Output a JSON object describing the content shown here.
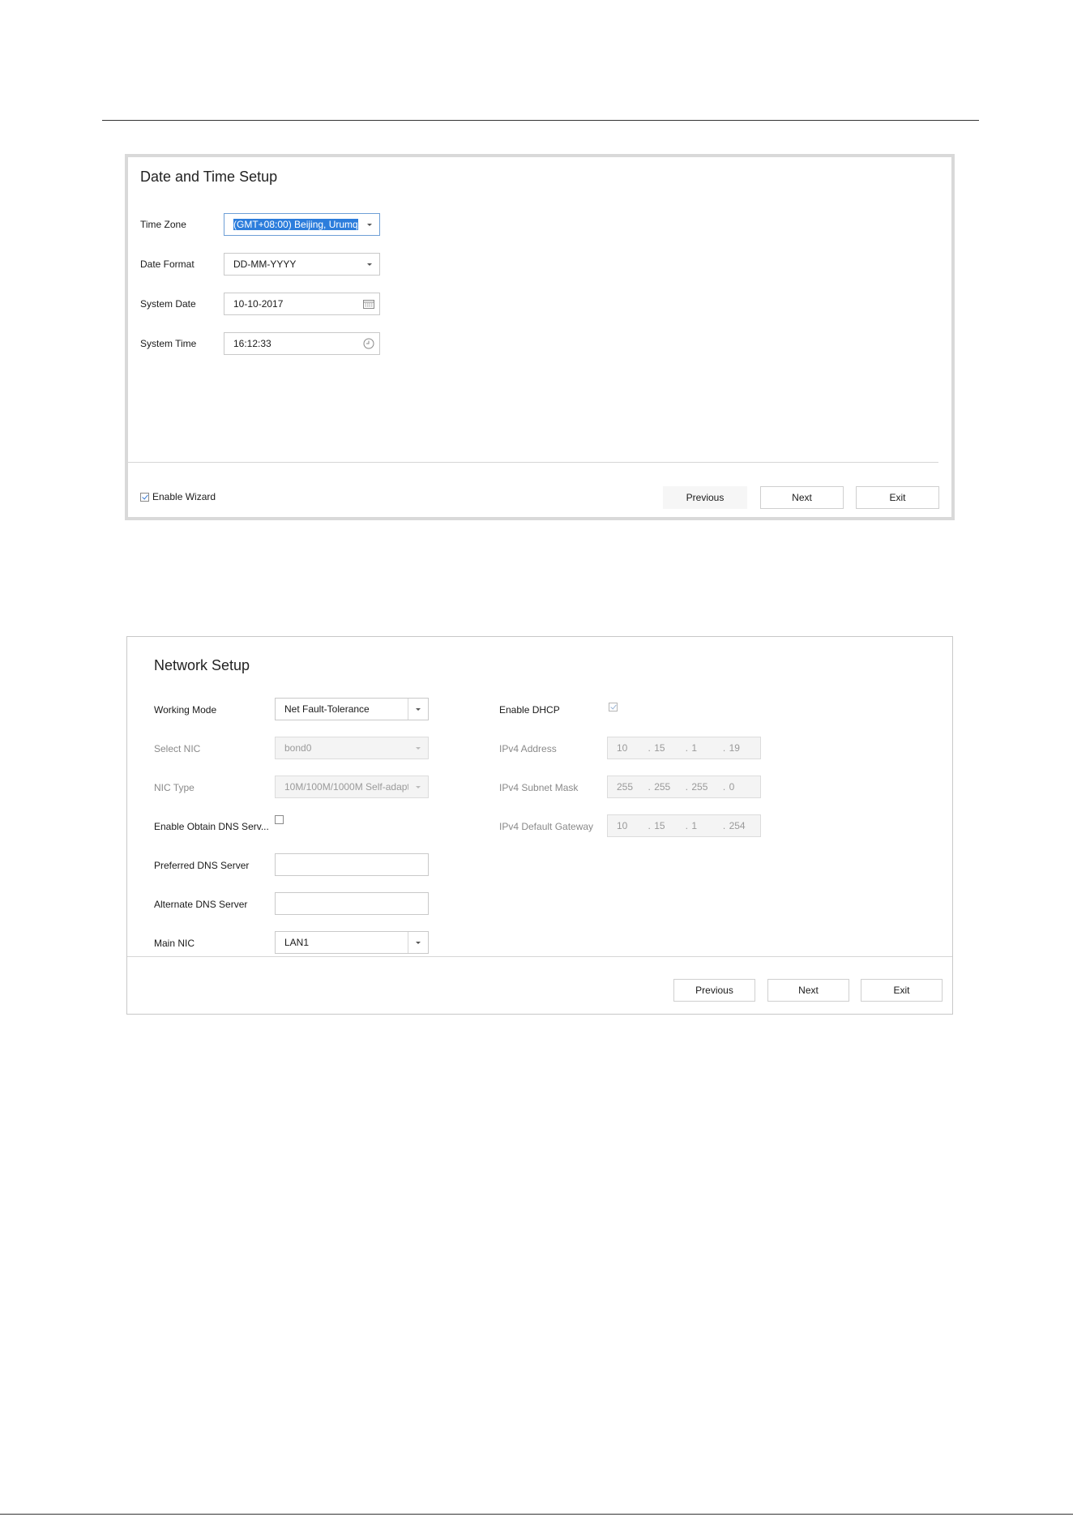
{
  "date_time_dialog": {
    "title": "Date and Time Setup",
    "fields": [
      {
        "label": "Time Zone",
        "value": "(GMT+08:00) Beijing, Urumq"
      },
      {
        "label": "Date Format",
        "value": "DD-MM-YYYY"
      },
      {
        "label": "System Date",
        "value": "10-10-2017"
      },
      {
        "label": "System Time",
        "value": "16:12:33"
      }
    ],
    "enable_wizard_label": "Enable Wizard",
    "enable_wizard_checked": true,
    "buttons": {
      "previous": "Previous",
      "next": "Next",
      "exit": "Exit"
    }
  },
  "network_dialog": {
    "title": "Network Setup",
    "left": [
      {
        "label": "Working Mode",
        "value": "Net Fault-Tolerance"
      },
      {
        "label": "Select NIC",
        "value": "bond0"
      },
      {
        "label": "NIC Type",
        "value": "10M/100M/1000M Self-adapt"
      },
      {
        "label": "Enable Obtain DNS Serv...",
        "checked": false
      },
      {
        "label": "Preferred DNS Server",
        "value": ""
      },
      {
        "label": "Alternate DNS Server",
        "value": ""
      },
      {
        "label": "Main NIC",
        "value": "LAN1"
      }
    ],
    "right": [
      {
        "label": "Enable DHCP",
        "checked": true
      },
      {
        "label": "IPv4 Address",
        "octets": [
          "10",
          "15",
          "1",
          "19"
        ]
      },
      {
        "label": "IPv4 Subnet Mask",
        "octets": [
          "255",
          "255",
          "255",
          "0"
        ]
      },
      {
        "label": "IPv4 Default Gateway",
        "octets": [
          "10",
          "15",
          "1",
          "254"
        ]
      }
    ],
    "ip_dot": ".",
    "buttons": {
      "previous": "Previous",
      "next": "Next",
      "exit": "Exit"
    }
  },
  "icons": {
    "calendar": "calendar-icon",
    "clock": "clock-icon",
    "dropdown": "chevron-down-icon",
    "check": "checkmark-icon"
  },
  "colors": {
    "selection": "#2c7ddc",
    "checkmark": "#3a7bd5",
    "disabled_bg": "#f4f4f4"
  }
}
